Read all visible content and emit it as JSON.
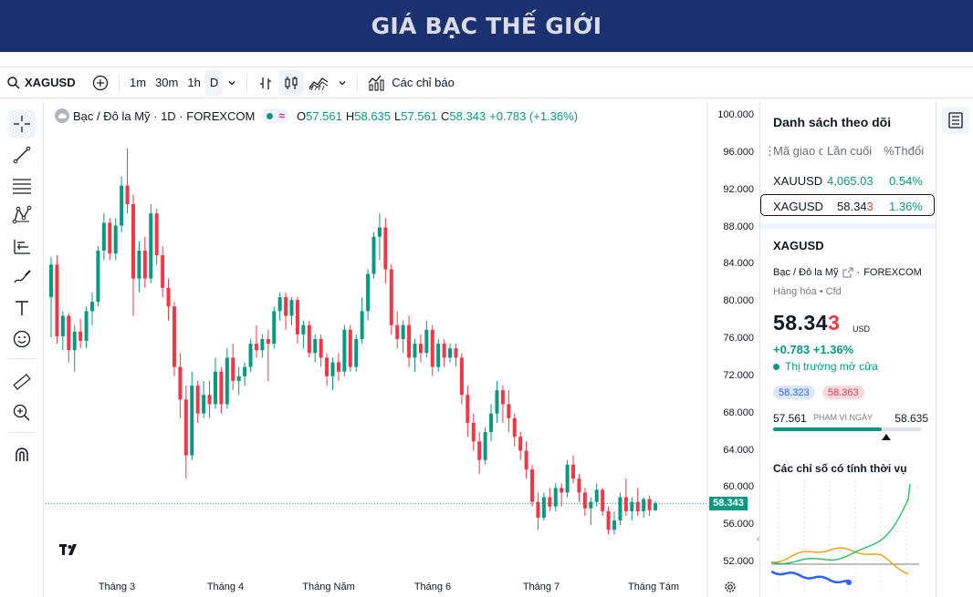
{
  "banner": {
    "title": "GIÁ BẠC THẾ GIỚI"
  },
  "toolbar": {
    "symbol": "XAGUSD",
    "intervals": [
      "1m",
      "30m",
      "1h",
      "D"
    ],
    "selected_interval": "D",
    "indicators_label": "Các chỉ báo"
  },
  "legend": {
    "title": "Bạc / Đô la Mỹ · 1D · FOREXCOM",
    "approx_symbol": "≈",
    "o_label": "O",
    "o": "57.561",
    "h_label": "H",
    "h": "58.635",
    "l_label": "L",
    "l": "57.561",
    "c_label": "C",
    "c": "58.343",
    "change": "+0.783 (+1.36%)"
  },
  "price_axis": {
    "labels": [
      "100.000",
      "96.000",
      "92.000",
      "88.000",
      "84.000",
      "80.000",
      "76.000",
      "72.000",
      "68.000",
      "64.000",
      "60.000",
      "56.000",
      "52.000"
    ],
    "last_price": "58.343"
  },
  "time_axis": {
    "labels": [
      "Tháng 3",
      "Tháng 4",
      "Tháng Năm",
      "Tháng 6",
      "Tháng 7",
      "Tháng Tám"
    ]
  },
  "watchlist": {
    "title": "Danh sách theo dõi",
    "columns": [
      "Mã giao dịch",
      "Lần cuối",
      "%Thđổi"
    ],
    "rows": [
      {
        "symbol": "XAUUSD",
        "last": "4,065.03",
        "change": "0.54%"
      },
      {
        "symbol": "XAGUSD",
        "last_main": "58.34",
        "last_tail": "3",
        "change": "1.36%"
      }
    ]
  },
  "details": {
    "symbol": "XAGUSD",
    "description": "Bạc / Đô la Mỹ",
    "exchange": "FOREXCOM",
    "type": "Hàng hóa • Cfd",
    "price_main": "58.34",
    "price_tail": "3",
    "currency": "USD",
    "change": "+0.783  +1.36%",
    "status": "Thị trường mở cửa",
    "bid": "58.323",
    "ask": "58.363",
    "range_low": "57.561",
    "range_label": "PHẠM VI NGÀY",
    "range_high": "58.635",
    "range_position": 0.73,
    "seasonals_title": "Các chỉ số có tính thời vụ"
  },
  "colors": {
    "up": "#089981",
    "down": "#f23645",
    "banner": "#1c3170",
    "accent": "#2962ff"
  },
  "chart_data": {
    "type": "candlestick",
    "symbol": "XAGUSD",
    "interval": "1D",
    "ylim": [
      50,
      100
    ],
    "x_labels": [
      "Tháng 3",
      "Tháng 4",
      "Tháng Năm",
      "Tháng 6",
      "Tháng 7",
      "Tháng Tám"
    ],
    "last_close": 58.343,
    "candles": [
      [
        80.5,
        84.8,
        76.2,
        84.0
      ],
      [
        84.0,
        85.0,
        75.5,
        76.3
      ],
      [
        76.3,
        79.0,
        74.8,
        78.5
      ],
      [
        78.5,
        78.8,
        73.5,
        74.8
      ],
      [
        74.8,
        77.5,
        72.5,
        76.8
      ],
      [
        76.8,
        78.2,
        75.0,
        75.8
      ],
      [
        75.8,
        79.5,
        75.0,
        79.0
      ],
      [
        79.0,
        81.0,
        77.5,
        80.0
      ],
      [
        80.0,
        86.0,
        79.5,
        85.5
      ],
      [
        85.5,
        89.5,
        84.5,
        88.5
      ],
      [
        88.5,
        89.0,
        84.5,
        85.2
      ],
      [
        85.2,
        89.0,
        84.5,
        88.2
      ],
      [
        88.2,
        93.5,
        87.5,
        92.5
      ],
      [
        92.5,
        96.5,
        89.5,
        90.5
      ],
      [
        90.5,
        91.5,
        78.5,
        82.5
      ],
      [
        82.5,
        86.5,
        81.0,
        85.5
      ],
      [
        85.5,
        87.0,
        81.5,
        82.5
      ],
      [
        82.5,
        90.5,
        82.0,
        89.5
      ],
      [
        89.5,
        90.0,
        84.0,
        85.0
      ],
      [
        85.0,
        86.0,
        80.5,
        81.5
      ],
      [
        81.5,
        82.5,
        78.0,
        79.5
      ],
      [
        79.5,
        80.0,
        72.0,
        73.0
      ],
      [
        73.0,
        74.5,
        67.5,
        69.5
      ],
      [
        69.5,
        71.0,
        61.0,
        63.5
      ],
      [
        63.5,
        72.5,
        63.0,
        71.0
      ],
      [
        71.0,
        71.5,
        67.0,
        68.0
      ],
      [
        68.0,
        71.5,
        67.5,
        70.0
      ],
      [
        70.0,
        71.5,
        67.5,
        69.0
      ],
      [
        69.0,
        74.0,
        68.5,
        72.5
      ],
      [
        72.5,
        73.0,
        68.0,
        69.0
      ],
      [
        69.0,
        75.0,
        68.5,
        74.0
      ],
      [
        74.0,
        75.5,
        70.5,
        71.5
      ],
      [
        71.5,
        73.0,
        70.0,
        72.0
      ],
      [
        72.0,
        73.5,
        71.0,
        73.0
      ],
      [
        73.0,
        76.0,
        72.5,
        75.5
      ],
      [
        75.5,
        77.5,
        74.0,
        74.8
      ],
      [
        74.8,
        76.5,
        74.0,
        76.0
      ],
      [
        76.0,
        77.0,
        71.5,
        75.5
      ],
      [
        75.5,
        79.5,
        75.0,
        79.0
      ],
      [
        79.0,
        81.0,
        78.0,
        80.5
      ],
      [
        80.5,
        81.0,
        77.0,
        78.5
      ],
      [
        78.5,
        80.5,
        77.5,
        80.2
      ],
      [
        80.2,
        80.5,
        75.5,
        76.5
      ],
      [
        76.5,
        78.0,
        75.0,
        77.5
      ],
      [
        77.5,
        78.0,
        74.0,
        74.5
      ],
      [
        74.5,
        76.5,
        73.5,
        76.0
      ],
      [
        76.0,
        76.5,
        73.0,
        74.0
      ],
      [
        74.0,
        74.5,
        71.0,
        72.0
      ],
      [
        72.0,
        74.0,
        70.5,
        73.5
      ],
      [
        73.5,
        74.5,
        71.5,
        72.5
      ],
      [
        72.5,
        77.5,
        72.0,
        77.0
      ],
      [
        77.0,
        77.5,
        72.5,
        73.0
      ],
      [
        73.0,
        76.5,
        72.5,
        76.0
      ],
      [
        76.0,
        80.5,
        75.5,
        79.0
      ],
      [
        79.0,
        83.5,
        78.0,
        83.0
      ],
      [
        83.0,
        87.5,
        82.5,
        87.0
      ],
      [
        87.0,
        89.5,
        84.5,
        88.0
      ],
      [
        88.0,
        89.0,
        82.0,
        83.5
      ],
      [
        83.5,
        84.0,
        76.5,
        77.5
      ],
      [
        77.5,
        79.0,
        75.0,
        76.0
      ],
      [
        76.0,
        78.0,
        74.5,
        77.5
      ],
      [
        77.5,
        78.5,
        73.0,
        74.0
      ],
      [
        74.0,
        76.0,
        72.5,
        75.5
      ],
      [
        75.5,
        76.5,
        73.5,
        74.5
      ],
      [
        74.5,
        78.0,
        74.0,
        77.0
      ],
      [
        77.0,
        77.5,
        72.0,
        73.0
      ],
      [
        73.0,
        76.0,
        72.5,
        75.5
      ],
      [
        75.5,
        76.0,
        73.0,
        74.0
      ],
      [
        74.0,
        75.5,
        73.5,
        75.0
      ],
      [
        75.0,
        75.5,
        73.0,
        74.0
      ],
      [
        74.0,
        74.5,
        69.0,
        70.0
      ],
      [
        70.0,
        71.0,
        65.5,
        67.0
      ],
      [
        67.0,
        68.0,
        64.0,
        65.0
      ],
      [
        65.0,
        66.0,
        61.5,
        63.0
      ],
      [
        63.0,
        66.5,
        62.5,
        66.0
      ],
      [
        66.0,
        69.0,
        65.0,
        68.0
      ],
      [
        68.0,
        71.5,
        67.0,
        70.5
      ],
      [
        70.5,
        71.0,
        67.0,
        69.0
      ],
      [
        69.0,
        70.5,
        66.0,
        67.5
      ],
      [
        67.5,
        68.0,
        64.5,
        65.5
      ],
      [
        65.5,
        66.0,
        63.0,
        64.0
      ],
      [
        64.0,
        65.0,
        61.0,
        62.0
      ],
      [
        62.0,
        62.5,
        58.0,
        58.5
      ],
      [
        58.5,
        59.5,
        55.5,
        56.8
      ],
      [
        56.8,
        59.5,
        56.5,
        59.0
      ],
      [
        59.0,
        60.0,
        57.5,
        58.0
      ],
      [
        58.0,
        60.5,
        57.5,
        60.0
      ],
      [
        60.0,
        60.5,
        58.0,
        59.5
      ],
      [
        59.5,
        63.0,
        59.0,
        62.5
      ],
      [
        62.5,
        63.5,
        60.5,
        61.0
      ],
      [
        61.0,
        61.5,
        58.5,
        59.5
      ],
      [
        59.5,
        60.0,
        57.0,
        57.8
      ],
      [
        57.8,
        59.0,
        56.0,
        58.5
      ],
      [
        58.5,
        60.5,
        58.0,
        59.8
      ],
      [
        59.8,
        60.0,
        57.0,
        57.5
      ],
      [
        57.5,
        58.0,
        55.0,
        55.5
      ],
      [
        55.5,
        57.5,
        55.0,
        56.5
      ],
      [
        56.5,
        59.5,
        56.0,
        59.0
      ],
      [
        59.0,
        61.0,
        57.0,
        57.5
      ],
      [
        57.5,
        59.0,
        56.5,
        58.5
      ],
      [
        58.5,
        60.0,
        57.0,
        57.5
      ],
      [
        57.5,
        59.0,
        56.8,
        58.8
      ],
      [
        58.8,
        59.2,
        57.0,
        57.6
      ],
      [
        57.6,
        58.6,
        57.5,
        58.343
      ]
    ]
  }
}
